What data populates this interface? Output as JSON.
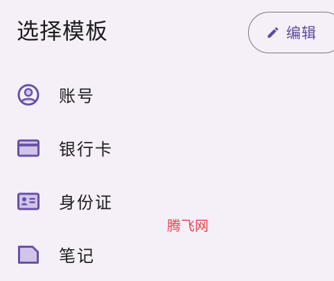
{
  "header": {
    "title": "选择模板",
    "edit_button": {
      "label": "编辑",
      "icon": "pencil-icon"
    }
  },
  "templates": [
    {
      "label": "账号",
      "icon": "account-circle-icon"
    },
    {
      "label": "银行卡",
      "icon": "credit-card-icon"
    },
    {
      "label": "身份证",
      "icon": "id-card-icon"
    },
    {
      "label": "笔记",
      "icon": "note-icon"
    }
  ],
  "watermark": "腾飞网",
  "colors": {
    "background": "#f5eff8",
    "accent": "#5b4aa0",
    "icon": "#6750a4",
    "text": "#1d1b20",
    "outline": "#7a757f",
    "watermark": "#e8474d"
  }
}
